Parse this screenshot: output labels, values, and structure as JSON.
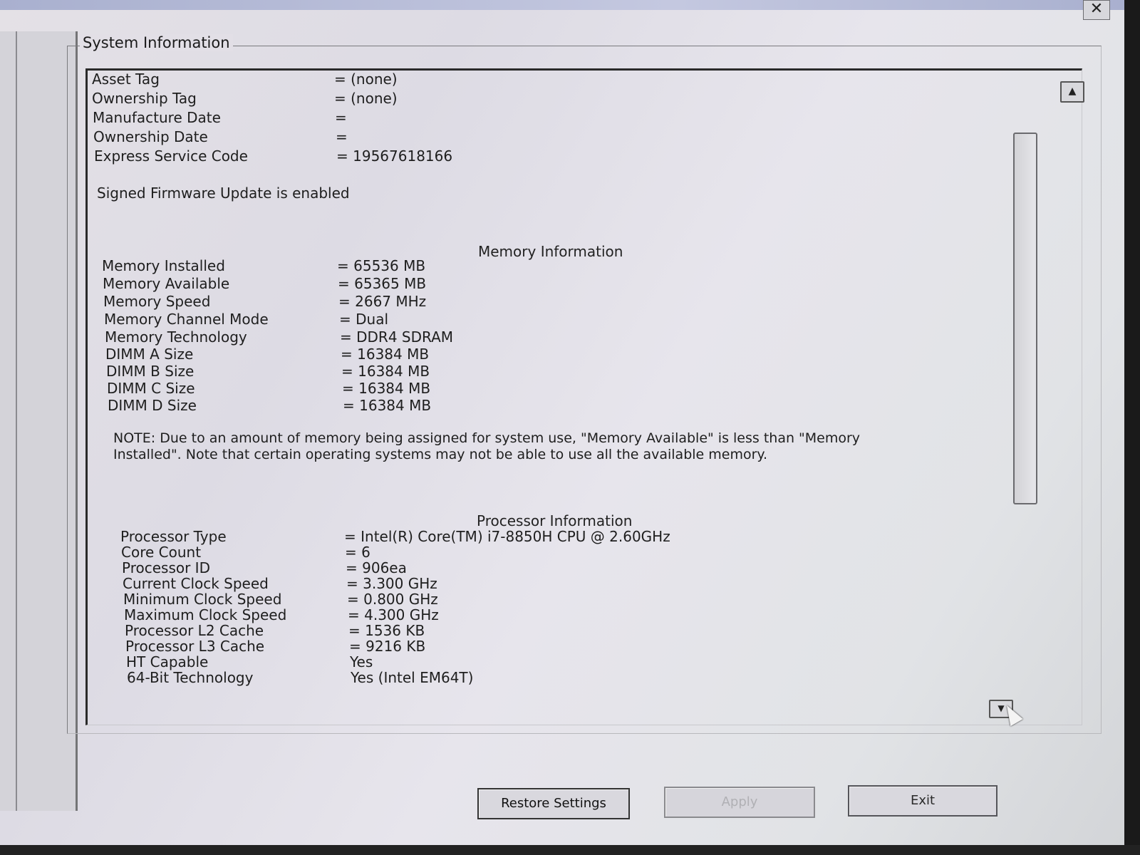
{
  "window": {
    "close_glyph": "✕"
  },
  "group_title": "System Information",
  "system_rows": [
    {
      "label": "Asset Tag",
      "value": "= (none)"
    },
    {
      "label": "Ownership Tag",
      "value": "= (none)"
    },
    {
      "label": "Manufacture Date",
      "value": "="
    },
    {
      "label": "Ownership Date",
      "value": "="
    },
    {
      "label": "Express Service Code",
      "value": "= 19567618166"
    }
  ],
  "firmware_status": "Signed Firmware Update is enabled",
  "memory": {
    "title": "Memory Information",
    "rows": [
      {
        "label": "Memory Installed",
        "value": "= 65536 MB"
      },
      {
        "label": "Memory Available",
        "value": "= 65365 MB"
      },
      {
        "label": "Memory Speed",
        "value": "= 2667 MHz"
      },
      {
        "label": "Memory Channel Mode",
        "value": "= Dual"
      },
      {
        "label": "Memory Technology",
        "value": "= DDR4 SDRAM"
      },
      {
        "label": "DIMM A Size",
        "value": "= 16384 MB"
      },
      {
        "label": "DIMM B Size",
        "value": "= 16384 MB"
      },
      {
        "label": "DIMM C Size",
        "value": "= 16384 MB"
      },
      {
        "label": "DIMM D Size",
        "value": "= 16384 MB"
      }
    ],
    "note": "NOTE: Due to an amount of memory being assigned for system use, \"Memory Available\" is less than \"Memory Installed\". Note that certain operating systems may not be able to use all the available memory."
  },
  "processor": {
    "title": "Processor Information",
    "rows": [
      {
        "label": "Processor Type",
        "value": "= Intel(R) Core(TM) i7-8850H CPU @ 2.60GHz"
      },
      {
        "label": "Core Count",
        "value": "= 6"
      },
      {
        "label": "Processor ID",
        "value": "= 906ea"
      },
      {
        "label": "Current Clock Speed",
        "value": "= 3.300 GHz"
      },
      {
        "label": "Minimum Clock Speed",
        "value": "= 0.800 GHz"
      },
      {
        "label": "Maximum Clock Speed",
        "value": "= 4.300 GHz"
      },
      {
        "label": "Processor L2 Cache",
        "value": "= 1536 KB"
      },
      {
        "label": "Processor L3 Cache",
        "value": "= 9216 KB"
      },
      {
        "label": "HT Capable",
        "value": "Yes"
      },
      {
        "label": "64-Bit Technology",
        "value": "Yes (Intel EM64T)"
      }
    ]
  },
  "scrollbar": {
    "up_glyph": "▲",
    "down_glyph": "▼"
  },
  "buttons": {
    "restore": "Restore Settings",
    "apply": "Apply",
    "exit": "Exit"
  }
}
